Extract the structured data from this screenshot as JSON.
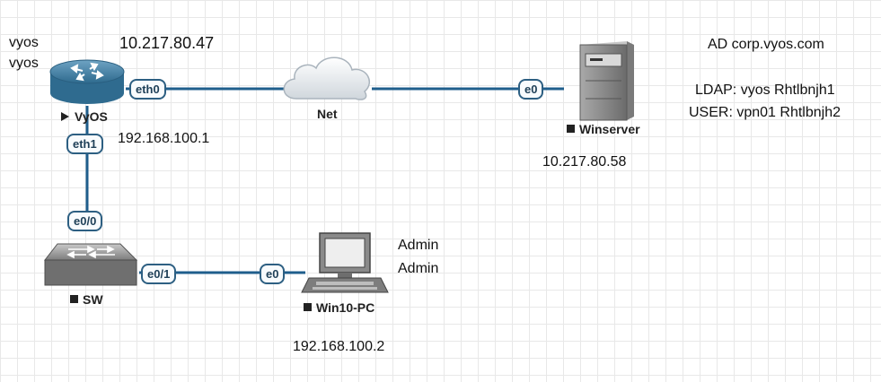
{
  "credentials": {
    "line1": "vyos",
    "line2": "vyos"
  },
  "router": {
    "name": "VyOS",
    "wan_ip": "10.217.80.47",
    "lan_ip": "192.168.100.1"
  },
  "cloud": {
    "name": "Net"
  },
  "server": {
    "name": "Winserver",
    "ip": "10.217.80.58"
  },
  "switch": {
    "name": "SW"
  },
  "pc": {
    "name": "Win10-PC",
    "ip": "192.168.100.2",
    "user": "Admin",
    "password": "Admin"
  },
  "ports": {
    "router_eth0": "eth0",
    "router_eth1": "eth1",
    "server_e0": "e0",
    "switch_e0_0": "e0/0",
    "switch_e0_1": "e0/1",
    "pc_e0": "e0"
  },
  "notes": {
    "ad": "AD corp.vyos.com",
    "ldap": "LDAP: vyos Rhtlbnjh1",
    "user": "USER: vpn01 Rhtlbnjh2"
  },
  "colors": {
    "link": "#1f5e8c",
    "port_border": "#2d5f82",
    "device": "#3f7fa3"
  }
}
